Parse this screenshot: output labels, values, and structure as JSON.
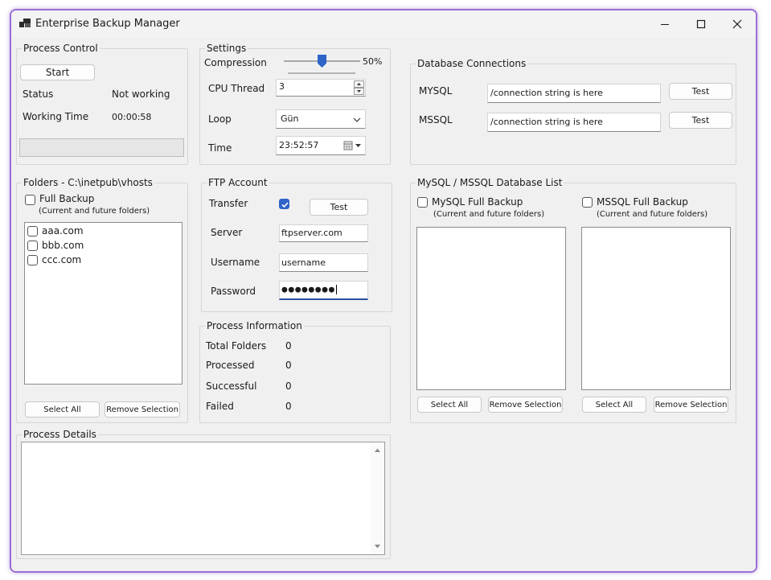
{
  "window": {
    "title": "Enterprise Backup Manager",
    "accent_color": "#9a6dd6"
  },
  "process_control": {
    "title": "Process Control",
    "start_label": "Start",
    "status_label": "Status",
    "status_value": "Not working",
    "working_time_label": "Working Time",
    "working_time_value": "00:00:58",
    "progress": 0
  },
  "settings": {
    "title": "Settings",
    "compression_label": "Compression",
    "compression_value": "50%",
    "compression_level": 0.5,
    "cpu_thread_label": "CPU Thread",
    "cpu_thread_value": "3",
    "loop_label": "Loop",
    "loop_value": "Gün",
    "time_label": "Time",
    "time_value": "23:52:57"
  },
  "database_connections": {
    "title": "Database Connections",
    "mysql_label": "MYSQL",
    "mysql_value": "/connection string is here",
    "mysql_test": "Test",
    "mssql_label": "MSSQL",
    "mssql_value": "/connection string is here",
    "mssql_test": "Test"
  },
  "folders": {
    "title": "Folders - C:\\inetpub\\vhosts",
    "full_backup_label": "Full Backup",
    "full_backup_hint": "(Current and future folders)",
    "items": [
      {
        "label": "aaa.com",
        "checked": false
      },
      {
        "label": "bbb.com",
        "checked": false
      },
      {
        "label": "ccc.com",
        "checked": false
      }
    ],
    "select_all": "Select All",
    "remove_selection": "Remove Selection"
  },
  "ftp": {
    "title": "FTP Account",
    "transfer_label": "Transfer",
    "transfer_checked": true,
    "test_label": "Test",
    "server_label": "Server",
    "server_value": "ftpserver.com",
    "username_label": "Username",
    "username_value": "username",
    "password_label": "Password",
    "password_value": "●●●●●●●●"
  },
  "process_information": {
    "title": "Process Information",
    "total_folders_label": "Total Folders",
    "total_folders_value": "0",
    "processed_label": "Processed",
    "processed_value": "0",
    "successful_label": "Successful",
    "successful_value": "0",
    "failed_label": "Failed",
    "failed_value": "0"
  },
  "db_list": {
    "title": "MySQL / MSSQL Database  List",
    "mysql_full_backup_label": "MySQL Full Backup",
    "mysql_hint": "(Current and future folders)",
    "mssql_full_backup_label": "MSSQL Full Backup",
    "mssql_hint": "(Current and future folders)",
    "mysql_select_all": "Select All",
    "mysql_remove_selection": "Remove Selection",
    "mssql_select_all": "Select All",
    "mssql_remove_selection": "Remove Selection"
  },
  "process_details": {
    "title": "Process Details",
    "text": ""
  }
}
